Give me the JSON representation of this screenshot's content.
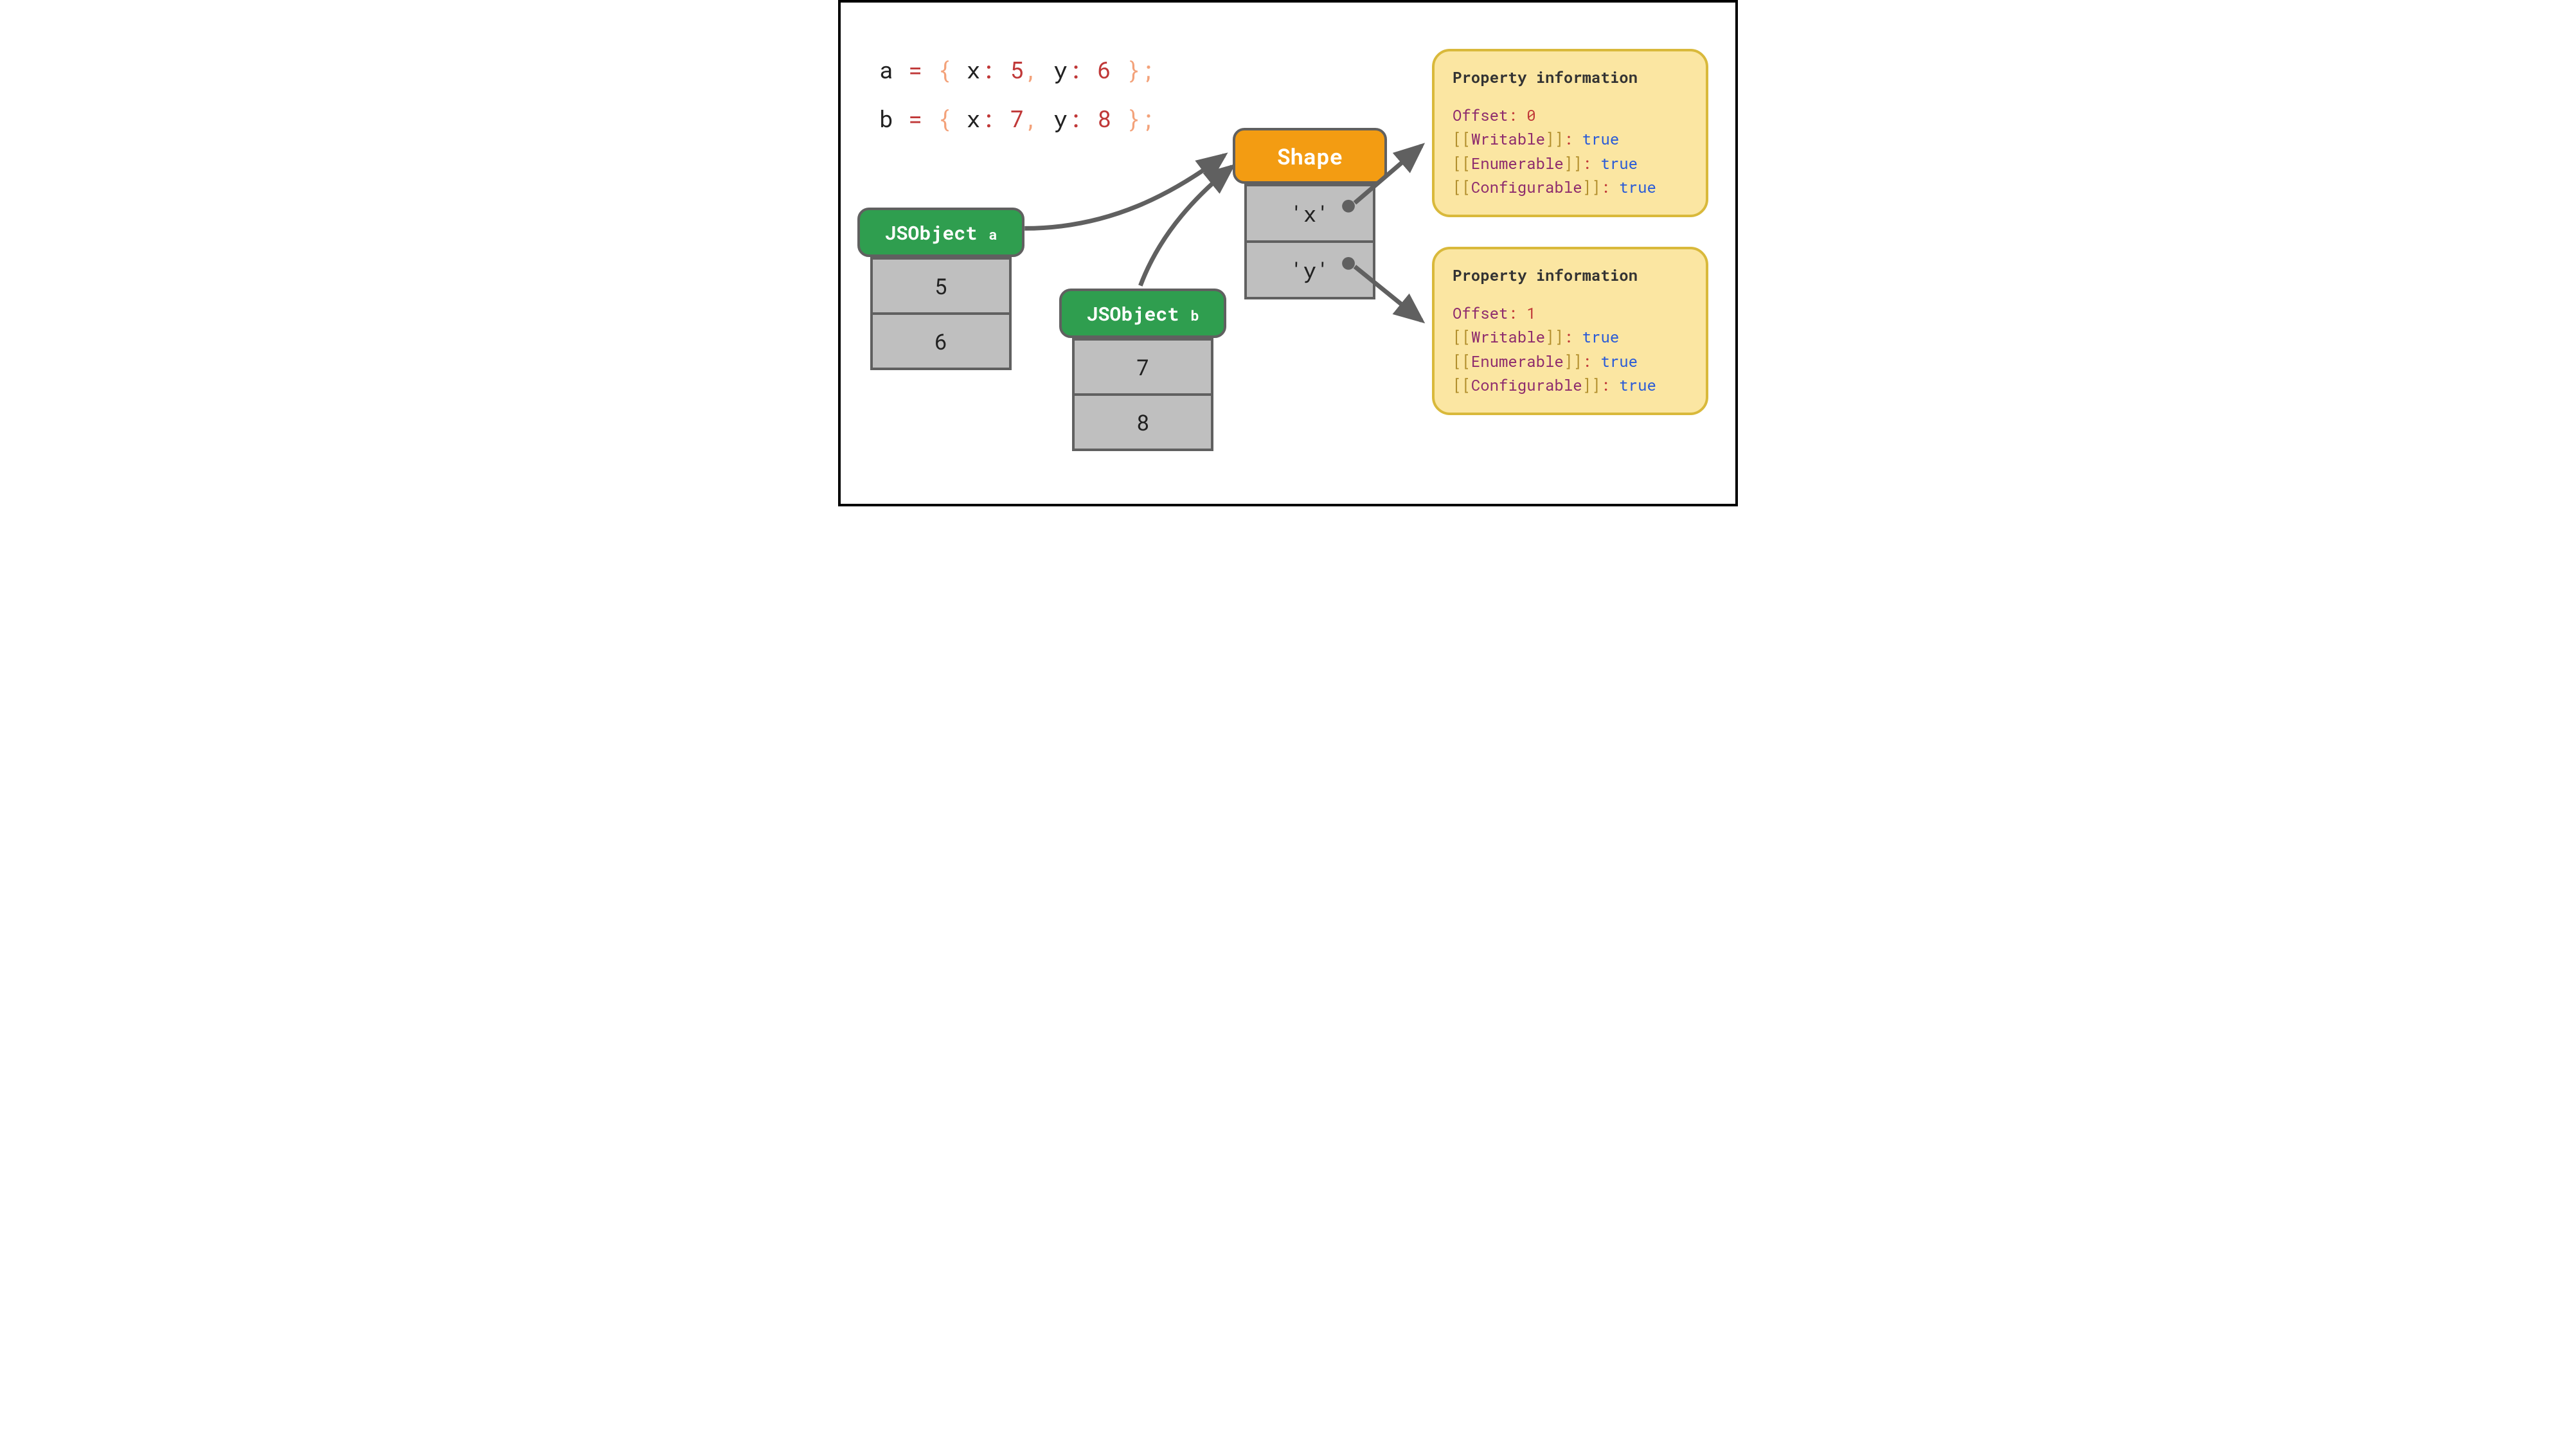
{
  "code": {
    "a": {
      "var": "a",
      "x_key": "x",
      "x_val": "5",
      "y_key": "y",
      "y_val": "6"
    },
    "b": {
      "var": "b",
      "x_key": "x",
      "x_val": "7",
      "y_key": "y",
      "y_val": "8"
    }
  },
  "jsobject_a": {
    "header_main": "JSObject ",
    "header_sub": "a",
    "cells": [
      "5",
      "6"
    ]
  },
  "jsobject_b": {
    "header_main": "JSObject ",
    "header_sub": "b",
    "cells": [
      "7",
      "8"
    ]
  },
  "shape": {
    "title": "Shape",
    "cells": [
      "'x'",
      "'y'"
    ]
  },
  "propinfo_x": {
    "title": "Property information",
    "offset_key": "Offset",
    "offset_val": "0",
    "writable_key": "Writable",
    "writable_val": "true",
    "enumerable_key": "Enumerable",
    "enumerable_val": "true",
    "configurable_key": "Configurable",
    "configurable_val": "true"
  },
  "propinfo_y": {
    "title": "Property information",
    "offset_key": "Offset",
    "offset_val": "1",
    "writable_key": "Writable",
    "writable_val": "true",
    "enumerable_key": "Enumerable",
    "enumerable_val": "true",
    "configurable_key": "Configurable",
    "configurable_val": "true"
  }
}
